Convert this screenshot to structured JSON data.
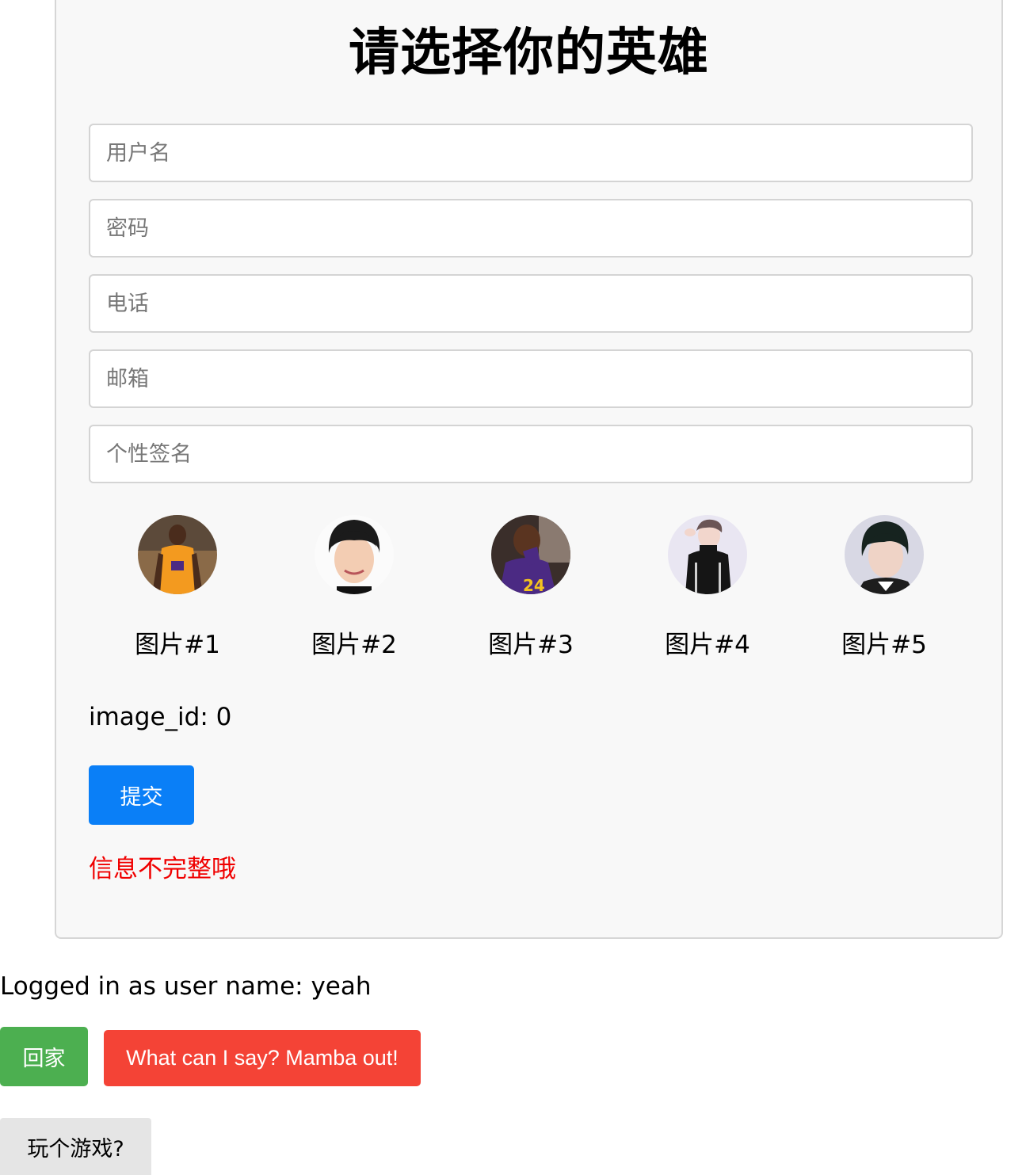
{
  "form": {
    "title": "请选择你的英雄",
    "fields": [
      {
        "placeholder": "用户名"
      },
      {
        "placeholder": "密码"
      },
      {
        "placeholder": "电话"
      },
      {
        "placeholder": "邮箱"
      },
      {
        "placeholder": "个性签名"
      }
    ],
    "avatars": [
      {
        "label": "图片#1"
      },
      {
        "label": "图片#2"
      },
      {
        "label": "图片#3"
      },
      {
        "label": "图片#4"
      },
      {
        "label": "图片#5"
      }
    ],
    "image_id_text": "image_id: 0",
    "submit_label": "提交",
    "error_text": "信息不完整哦"
  },
  "footer": {
    "logged_in_text": "Logged in as user name: yeah",
    "home_label": "回家",
    "mamba_label": "What can I say? Mamba out!",
    "game_label": "玩个游戏?"
  }
}
